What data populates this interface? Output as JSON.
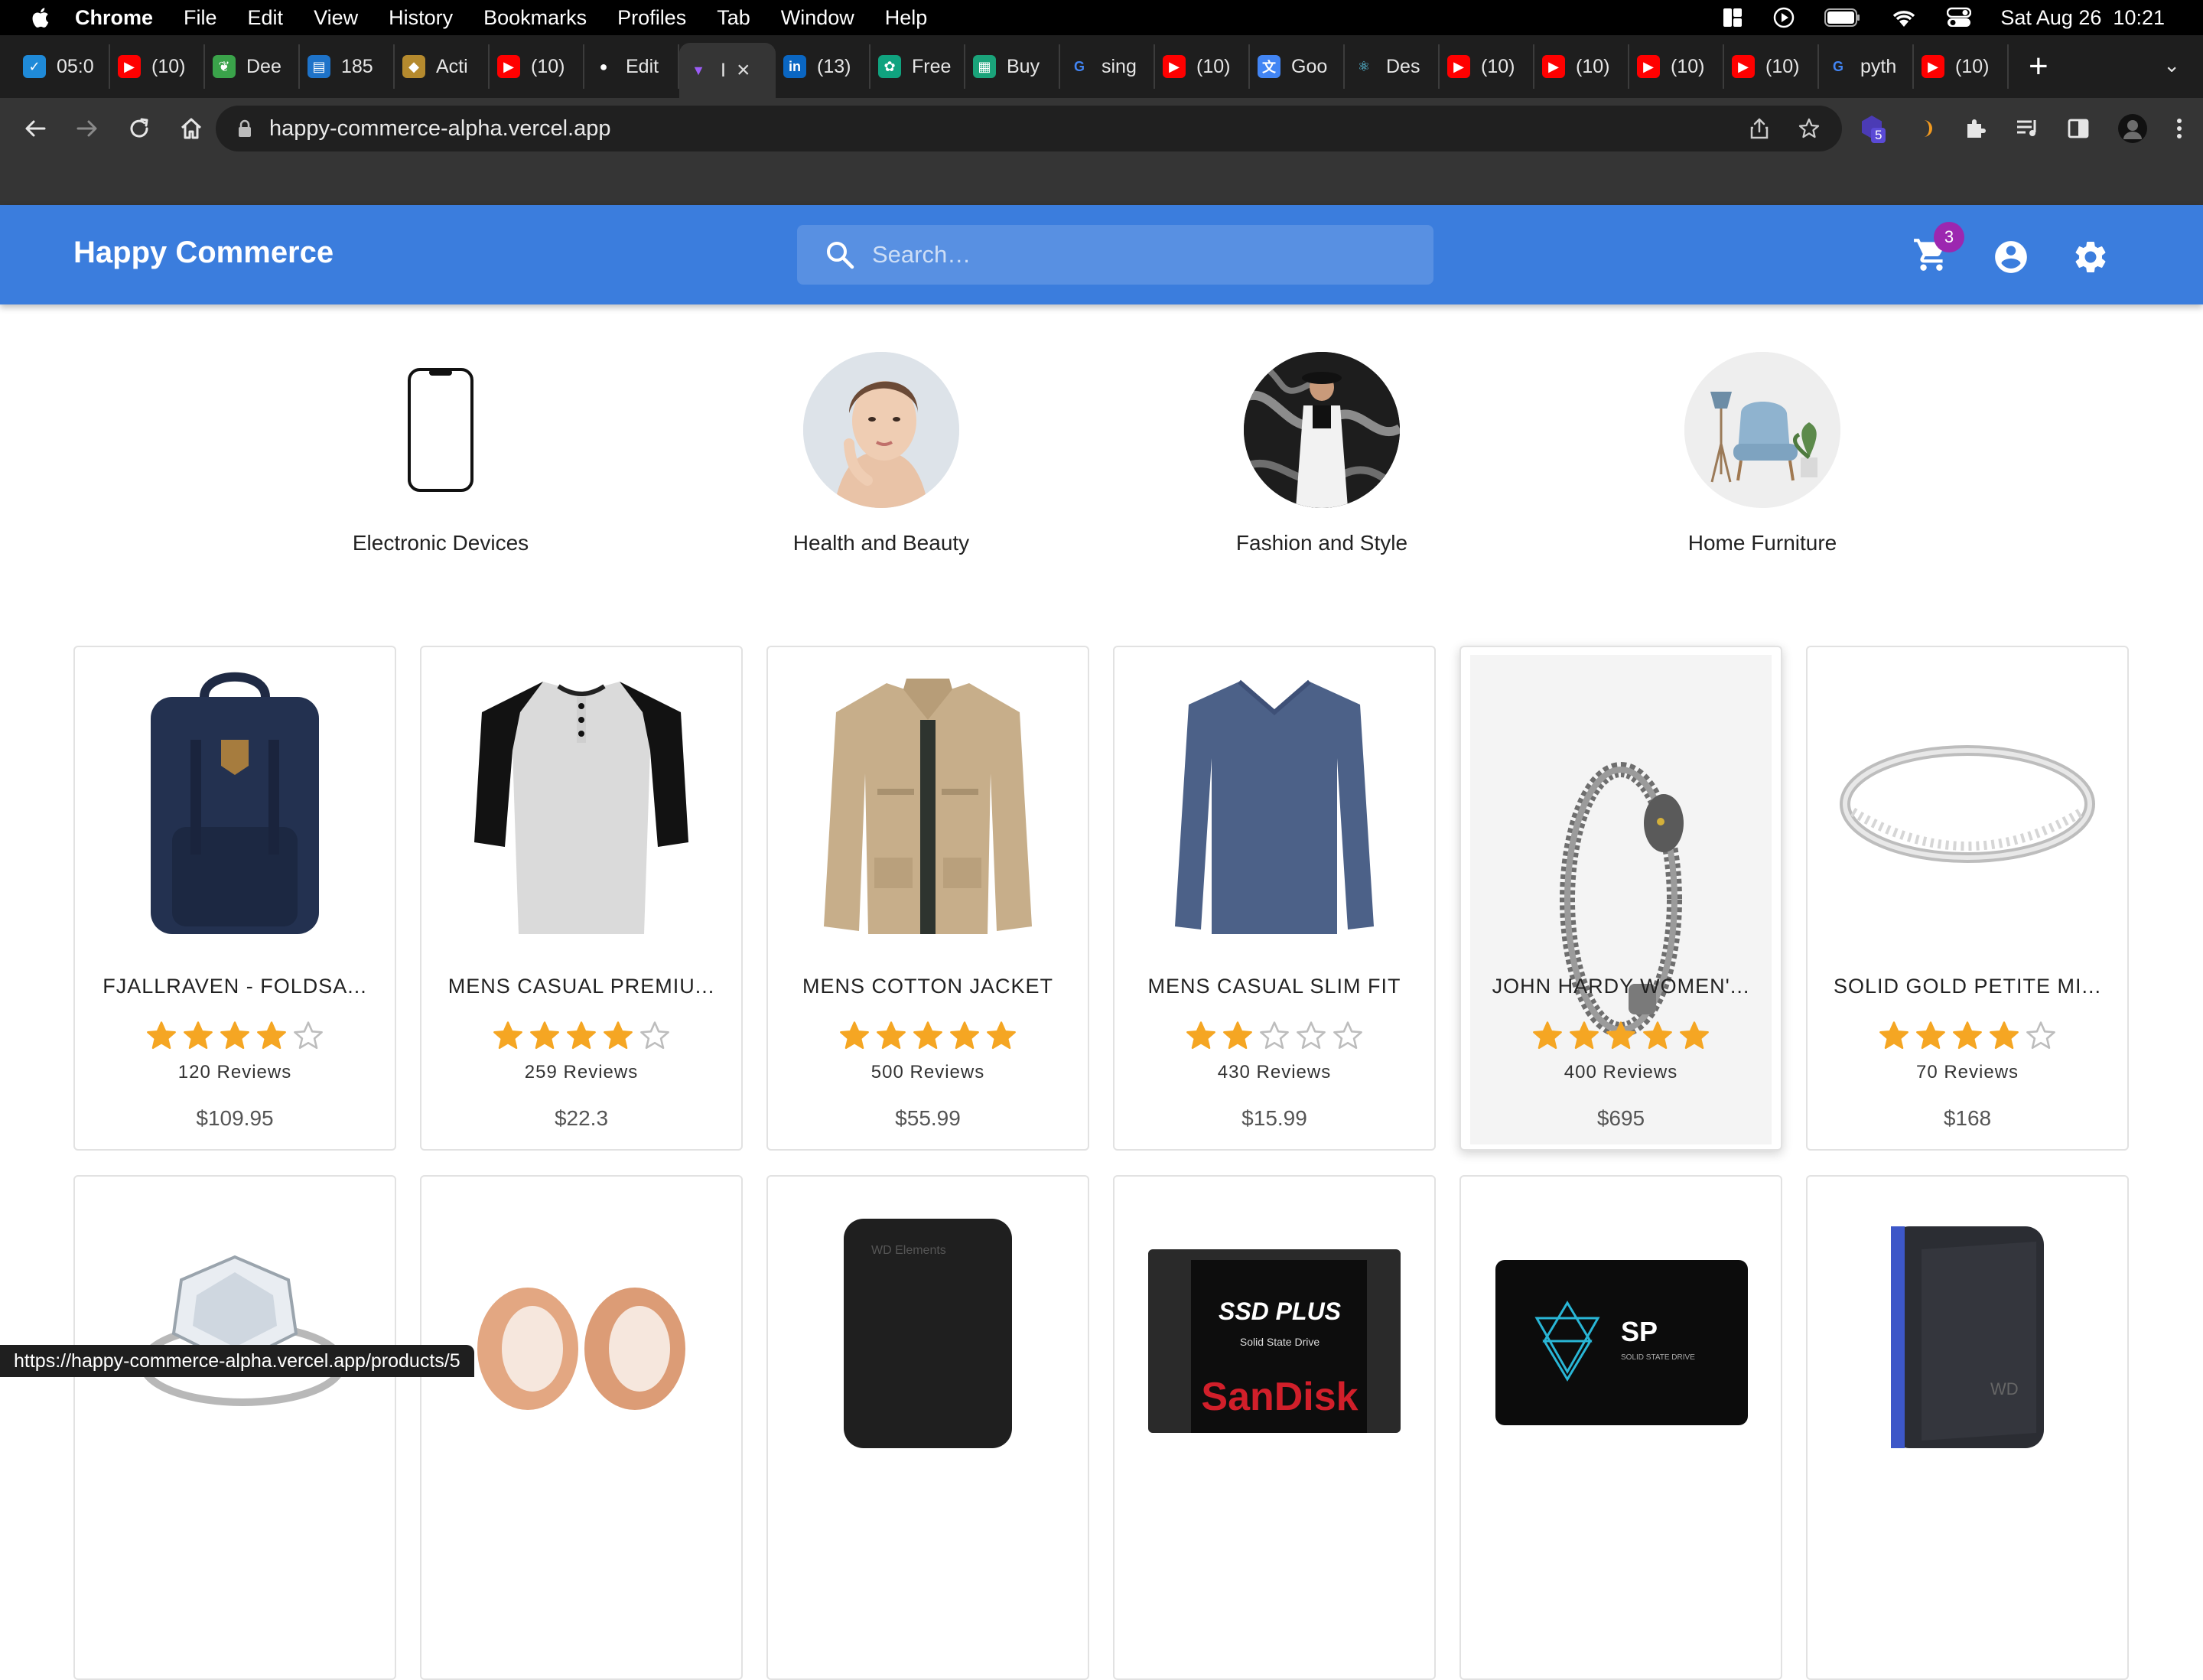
{
  "menubar": {
    "app": "Chrome",
    "items": [
      "File",
      "Edit",
      "View",
      "History",
      "Bookmarks",
      "Profiles",
      "Tab",
      "Window",
      "Help"
    ],
    "datetime": "Sat Aug 26  10:21"
  },
  "tabs": [
    {
      "label": "05:0",
      "icon": "check-circle-icon",
      "color": "#1f8ad8"
    },
    {
      "label": "(10)",
      "icon": "youtube-icon",
      "color": "#ff0000"
    },
    {
      "label": "Dee",
      "icon": "leaf-icon",
      "color": "#3aa34a"
    },
    {
      "label": "185",
      "icon": "doc-icon",
      "color": "#1e73c9"
    },
    {
      "label": "Acti",
      "icon": "buffalo-icon",
      "color": "#b58a2e"
    },
    {
      "label": "(10)",
      "icon": "youtube-icon",
      "color": "#ff0000"
    },
    {
      "label": "Edit",
      "icon": "github-icon",
      "color": "#ffffff"
    },
    {
      "label": "I",
      "icon": "vite-icon",
      "color": "#9b5cf6",
      "active": true
    },
    {
      "label": "(13)",
      "icon": "linkedin-icon",
      "color": "#0a66c2"
    },
    {
      "label": "Free",
      "icon": "openai-icon",
      "color": "#10a37f"
    },
    {
      "label": "Buy",
      "icon": "shop-icon",
      "color": "#1aa37a"
    },
    {
      "label": "sing",
      "icon": "google-icon",
      "color": "#4285f4"
    },
    {
      "label": "(10)",
      "icon": "youtube-icon",
      "color": "#ff0000"
    },
    {
      "label": "Goo",
      "icon": "translate-icon",
      "color": "#4285f4"
    },
    {
      "label": "Des",
      "icon": "react-icon",
      "color": "#61dafb"
    },
    {
      "label": "(10)",
      "icon": "youtube-icon",
      "color": "#ff0000"
    },
    {
      "label": "(10)",
      "icon": "youtube-icon",
      "color": "#ff0000"
    },
    {
      "label": "(10)",
      "icon": "youtube-icon",
      "color": "#ff0000"
    },
    {
      "label": "(10)",
      "icon": "youtube-icon",
      "color": "#ff0000"
    },
    {
      "label": "pyth",
      "icon": "google-icon",
      "color": "#4285f4"
    },
    {
      "label": "(10)",
      "icon": "youtube-icon",
      "color": "#ff0000"
    }
  ],
  "address": {
    "url": "happy-commerce-alpha.vercel.app"
  },
  "extensions": {
    "badge": "5"
  },
  "header": {
    "brand": "Happy Commerce",
    "search_placeholder": "Search…",
    "cart_count": "3",
    "accent": "#3b7ddd"
  },
  "categories": [
    {
      "label": "Electronic Devices",
      "icon": "phone-icon"
    },
    {
      "label": "Health and Beauty",
      "icon": "beauty-face-icon"
    },
    {
      "label": "Fashion and Style",
      "icon": "fashion-icon"
    },
    {
      "label": "Home Furniture",
      "icon": "armchair-icon"
    }
  ],
  "products": [
    {
      "title": "FJALLRAVEN - FOLDSA...",
      "rating": 4,
      "reviews": "120 Reviews",
      "price": "$109.95",
      "image": "backpack-icon"
    },
    {
      "title": "MENS CASUAL PREMIU...",
      "rating": 4,
      "reviews": "259 Reviews",
      "price": "$22.3",
      "image": "raglan-shirt-icon"
    },
    {
      "title": "MENS COTTON JACKET",
      "rating": 5,
      "reviews": "500 Reviews",
      "price": "$55.99",
      "image": "jacket-icon"
    },
    {
      "title": "MENS CASUAL SLIM FIT",
      "rating": 2,
      "reviews": "430 Reviews",
      "price": "$15.99",
      "image": "longsleeve-icon"
    },
    {
      "title": "JOHN HARDY WOMEN'...",
      "rating": 5,
      "reviews": "400 Reviews",
      "price": "$695",
      "image": "bracelet-icon",
      "hover": true
    },
    {
      "title": "SOLID GOLD PETITE MI...",
      "rating": 4,
      "reviews": "70 Reviews",
      "price": "$168",
      "image": "ring-icon"
    },
    {
      "title": "",
      "rating": 0,
      "reviews": "",
      "price": "",
      "image": "diamond-ring-icon"
    },
    {
      "title": "",
      "rating": 0,
      "reviews": "",
      "price": "",
      "image": "rose-gold-tunnels-icon"
    },
    {
      "title": "",
      "rating": 0,
      "reviews": "",
      "price": "",
      "image": "wd-drive-icon"
    },
    {
      "title": "",
      "rating": 0,
      "reviews": "",
      "price": "",
      "image": "ssd-plus-icon",
      "badge_text": "SSD PLUS"
    },
    {
      "title": "",
      "rating": 0,
      "reviews": "",
      "price": "",
      "image": "sp-ssd-icon",
      "badge_text": "SP"
    },
    {
      "title": "",
      "rating": 0,
      "reviews": "",
      "price": "",
      "image": "wd-gaming-drive-icon"
    }
  ],
  "status": {
    "link": "https://happy-commerce-alpha.vercel.app/products/5"
  }
}
